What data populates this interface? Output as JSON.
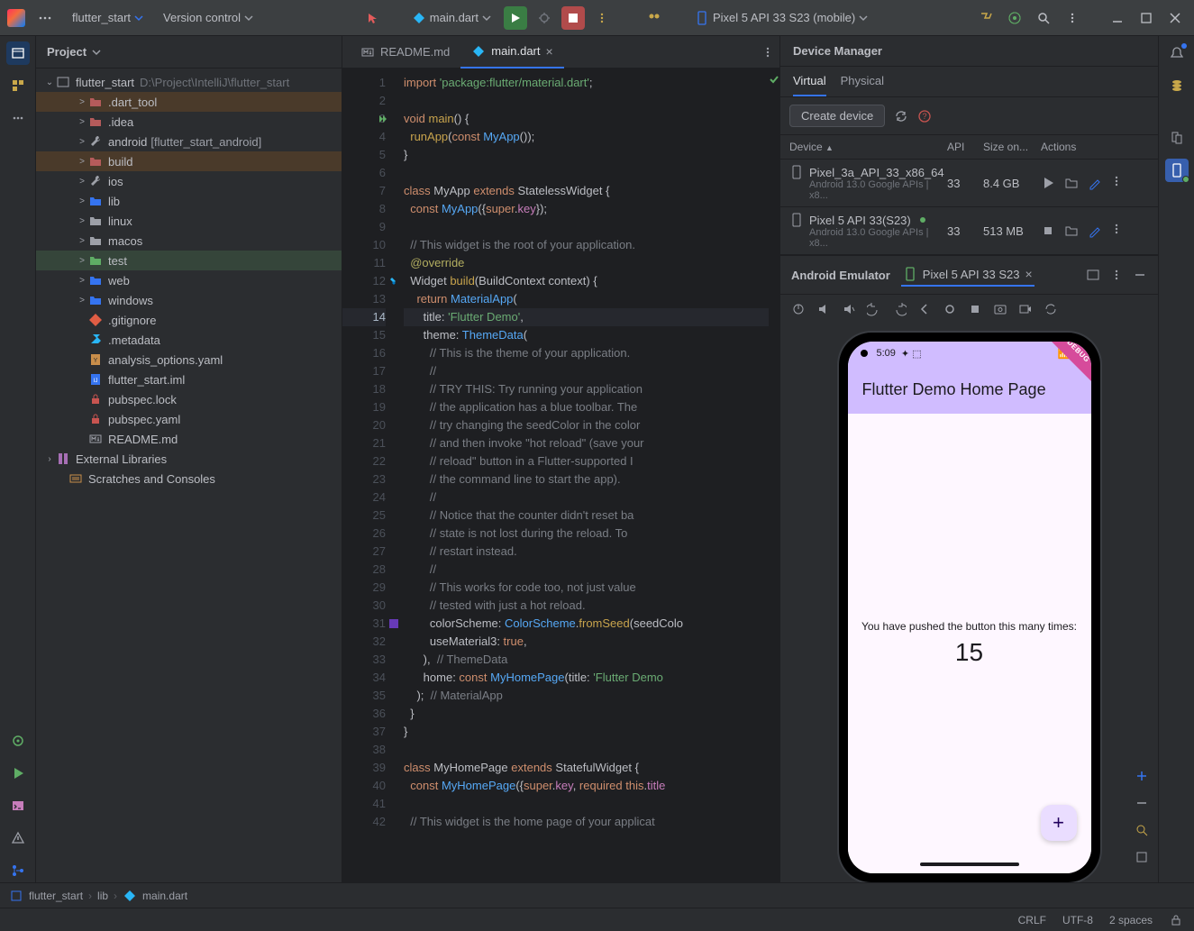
{
  "titlebar": {
    "project": "flutter_start",
    "vcs": "Version control",
    "run_config": "main.dart",
    "device": "Pixel 5 API 33 S23  (mobile)"
  },
  "project_panel": {
    "title": "Project",
    "root": "flutter_start",
    "root_path": "D:\\Project\\IntelliJ\\flutter_start",
    "items": [
      {
        "label": ".dart_tool",
        "icon": "folder-red",
        "arrow": ">",
        "indent": 2,
        "sel": "sel1"
      },
      {
        "label": ".idea",
        "icon": "folder-red",
        "arrow": ">",
        "indent": 2
      },
      {
        "label": "android",
        "icon": "wrench",
        "arrow": ">",
        "indent": 2,
        "extra": "[flutter_start_android]"
      },
      {
        "label": "build",
        "icon": "folder-red",
        "arrow": ">",
        "indent": 2,
        "sel": "sel1"
      },
      {
        "label": "ios",
        "icon": "wrench",
        "arrow": ">",
        "indent": 2
      },
      {
        "label": "lib",
        "icon": "folder-blue",
        "arrow": ">",
        "indent": 2
      },
      {
        "label": "linux",
        "icon": "folder",
        "arrow": ">",
        "indent": 2
      },
      {
        "label": "macos",
        "icon": "folder",
        "arrow": ">",
        "indent": 2
      },
      {
        "label": "test",
        "icon": "folder-green",
        "arrow": ">",
        "indent": 2,
        "sel": "sel2"
      },
      {
        "label": "web",
        "icon": "folder-blue",
        "arrow": ">",
        "indent": 2
      },
      {
        "label": "windows",
        "icon": "folder-blue",
        "arrow": ">",
        "indent": 2
      },
      {
        "label": ".gitignore",
        "icon": "git",
        "arrow": "",
        "indent": 2
      },
      {
        "label": ".metadata",
        "icon": "meta",
        "arrow": "",
        "indent": 2
      },
      {
        "label": "analysis_options.yaml",
        "icon": "yaml",
        "arrow": "",
        "indent": 2
      },
      {
        "label": "flutter_start.iml",
        "icon": "iml",
        "arrow": "",
        "indent": 2
      },
      {
        "label": "pubspec.lock",
        "icon": "lock",
        "arrow": "",
        "indent": 2
      },
      {
        "label": "pubspec.yaml",
        "icon": "lock",
        "arrow": "",
        "indent": 2
      },
      {
        "label": "README.md",
        "icon": "md",
        "arrow": "",
        "indent": 2
      }
    ],
    "ext_lib": "External Libraries",
    "scratches": "Scratches and Consoles"
  },
  "editor": {
    "tabs": [
      {
        "label": "README.md",
        "icon": "md"
      },
      {
        "label": "main.dart",
        "icon": "dart",
        "active": true
      }
    ],
    "highlight_line": 14,
    "lines": [
      {
        "n": 1,
        "h": "<span class='kw'>import</span> <span class='str'>'package:flutter/material.dart'</span>;"
      },
      {
        "n": 2,
        "h": ""
      },
      {
        "n": 3,
        "h": "<span class='kw'>void</span> <span class='fn'>main</span>() {",
        "mark": "run"
      },
      {
        "n": 4,
        "h": "  <span class='fn'>runApp</span>(<span class='kw'>const</span> <span class='fn2'>MyApp</span>());"
      },
      {
        "n": 5,
        "h": "}"
      },
      {
        "n": 6,
        "h": ""
      },
      {
        "n": 7,
        "h": "<span class='kw'>class</span> <span class='nm'>MyApp</span> <span class='kw'>extends</span> <span class='nm'>StatelessWidget</span> {"
      },
      {
        "n": 8,
        "h": "  <span class='kw'>const</span> <span class='fn2'>MyApp</span>({<span class='kw'>super</span>.<span class='prp'>key</span>});"
      },
      {
        "n": 9,
        "h": ""
      },
      {
        "n": 10,
        "h": "  <span class='cm'>// This widget is the root of your application.</span>"
      },
      {
        "n": 11,
        "h": "  <span class='ann'>@override</span>"
      },
      {
        "n": 12,
        "h": "  <span class='nm'>Widget</span> <span class='fn'>build</span>(<span class='nm'>BuildContext</span> context) {",
        "mark": "flutter"
      },
      {
        "n": 13,
        "h": "    <span class='kw'>return</span> <span class='fn2'>MaterialApp</span>("
      },
      {
        "n": 14,
        "h": "      title: <span class='str'>'Flutter Demo'</span>,"
      },
      {
        "n": 15,
        "h": "      theme: <span class='fn2'>ThemeData</span>("
      },
      {
        "n": 16,
        "h": "        <span class='cm'>// This is the theme of your application.</span>"
      },
      {
        "n": 17,
        "h": "        <span class='cm'>//</span>"
      },
      {
        "n": 18,
        "h": "        <span class='cm'>// TRY THIS: Try running your application </span>"
      },
      {
        "n": 19,
        "h": "        <span class='cm'>// the application has a blue toolbar. The</span>"
      },
      {
        "n": 20,
        "h": "        <span class='cm'>// try changing the seedColor in the color</span>"
      },
      {
        "n": 21,
        "h": "        <span class='cm'>// and then invoke \"hot reload\" (save your</span>"
      },
      {
        "n": 22,
        "h": "        <span class='cm'>// reload\" button in a Flutter-supported I</span>"
      },
      {
        "n": 23,
        "h": "        <span class='cm'>// the command line to start the app).</span>"
      },
      {
        "n": 24,
        "h": "        <span class='cm'>//</span>"
      },
      {
        "n": 25,
        "h": "        <span class='cm'>// Notice that the counter didn't reset ba</span>"
      },
      {
        "n": 26,
        "h": "        <span class='cm'>// state is not lost during the reload. To</span>"
      },
      {
        "n": 27,
        "h": "        <span class='cm'>// restart instead.</span>"
      },
      {
        "n": 28,
        "h": "        <span class='cm'>//</span>"
      },
      {
        "n": 29,
        "h": "        <span class='cm'>// This works for code too, not just value</span>"
      },
      {
        "n": 30,
        "h": "        <span class='cm'>// tested with just a hot reload.</span>"
      },
      {
        "n": 31,
        "h": "        colorScheme: <span class='fn2'>ColorScheme</span>.<span class='fn'>fromSeed</span>(seedColo",
        "mark": "color"
      },
      {
        "n": 32,
        "h": "        useMaterial3: <span class='kw'>true</span>,"
      },
      {
        "n": 33,
        "h": "      ),  <span class='cm'>// ThemeData</span>"
      },
      {
        "n": 34,
        "h": "      home: <span class='kw'>const</span> <span class='fn2'>MyHomePage</span>(title: <span class='str'>'Flutter Demo</span>"
      },
      {
        "n": 35,
        "h": "    );  <span class='cm'>// MaterialApp</span>"
      },
      {
        "n": 36,
        "h": "  }"
      },
      {
        "n": 37,
        "h": "}"
      },
      {
        "n": 38,
        "h": ""
      },
      {
        "n": 39,
        "h": "<span class='kw'>class</span> <span class='nm'>MyHomePage</span> <span class='kw'>extends</span> <span class='nm'>StatefulWidget</span> {"
      },
      {
        "n": 40,
        "h": "  <span class='kw'>const</span> <span class='fn2'>MyHomePage</span>({<span class='kw'>super</span>.<span class='prp'>key</span>, <span class='kw'>required</span> <span class='kw'>this</span>.<span class='prp'>title</span>"
      },
      {
        "n": 41,
        "h": ""
      },
      {
        "n": 42,
        "h": "  <span class='cm'>// This widget is the home page of your applicat</span>"
      }
    ]
  },
  "device_manager": {
    "title": "Device Manager",
    "tabs": {
      "virtual": "Virtual",
      "physical": "Physical"
    },
    "create": "Create device",
    "cols": {
      "device": "Device",
      "api": "API",
      "size": "Size on...",
      "actions": "Actions"
    },
    "rows": [
      {
        "name": "Pixel_3a_API_33_x86_64",
        "sub": "Android 13.0 Google APIs | x8...",
        "api": "33",
        "size": "8.4 GB",
        "running": false
      },
      {
        "name": "Pixel 5 API 33(S23)",
        "sub": "Android 13.0 Google APIs | x8...",
        "api": "33",
        "size": "513 MB",
        "running": true
      }
    ]
  },
  "emulator": {
    "title": "Android Emulator",
    "tab": "Pixel 5 API 33 S23",
    "phone": {
      "time": "5:09",
      "app_title": "Flutter Demo Home Page",
      "message": "You have pushed the button this many times:",
      "count": "15",
      "debug": "DEBUG"
    }
  },
  "breadcrumb": [
    "flutter_start",
    "lib",
    "main.dart"
  ],
  "status": {
    "crlf": "CRLF",
    "enc": "UTF-8",
    "indent": "2 spaces"
  }
}
